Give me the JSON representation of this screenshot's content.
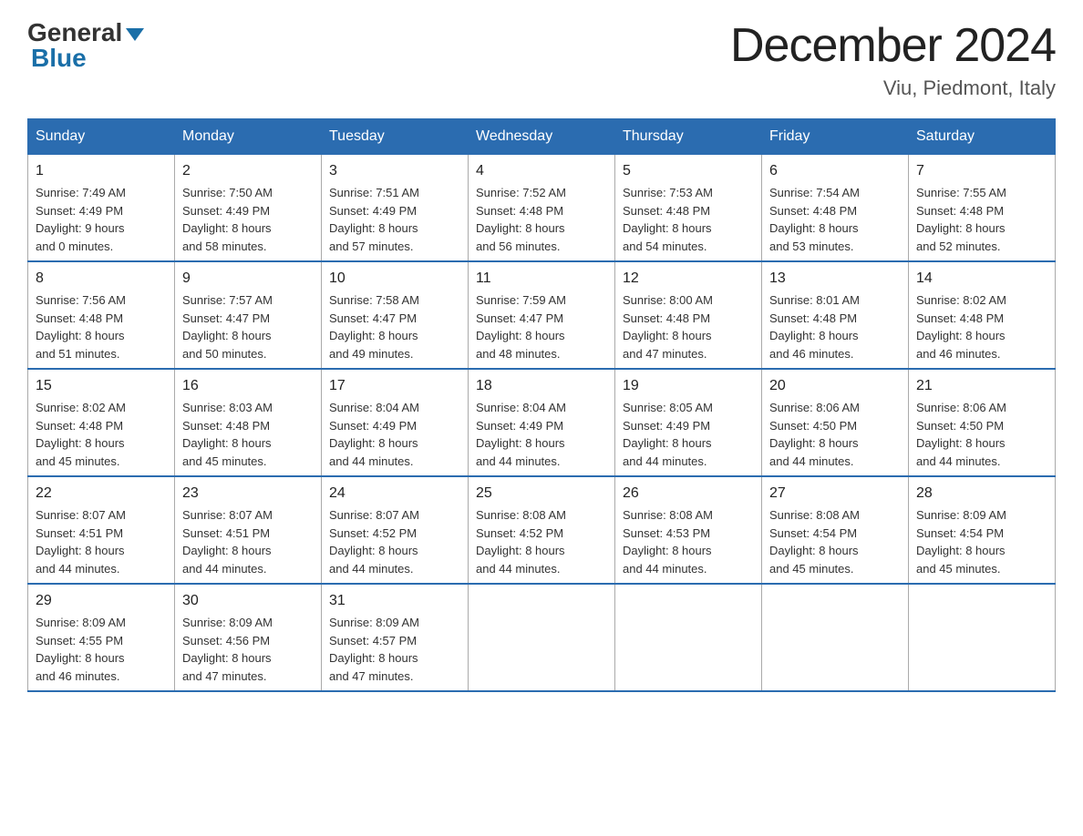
{
  "header": {
    "logo_general": "General",
    "logo_blue": "Blue",
    "month_title": "December 2024",
    "subtitle": "Viu, Piedmont, Italy"
  },
  "days_of_week": [
    "Sunday",
    "Monday",
    "Tuesday",
    "Wednesday",
    "Thursday",
    "Friday",
    "Saturday"
  ],
  "weeks": [
    [
      {
        "day": "1",
        "sunrise": "7:49 AM",
        "sunset": "4:49 PM",
        "daylight": "9 hours and 0 minutes."
      },
      {
        "day": "2",
        "sunrise": "7:50 AM",
        "sunset": "4:49 PM",
        "daylight": "8 hours and 58 minutes."
      },
      {
        "day": "3",
        "sunrise": "7:51 AM",
        "sunset": "4:49 PM",
        "daylight": "8 hours and 57 minutes."
      },
      {
        "day": "4",
        "sunrise": "7:52 AM",
        "sunset": "4:48 PM",
        "daylight": "8 hours and 56 minutes."
      },
      {
        "day": "5",
        "sunrise": "7:53 AM",
        "sunset": "4:48 PM",
        "daylight": "8 hours and 54 minutes."
      },
      {
        "day": "6",
        "sunrise": "7:54 AM",
        "sunset": "4:48 PM",
        "daylight": "8 hours and 53 minutes."
      },
      {
        "day": "7",
        "sunrise": "7:55 AM",
        "sunset": "4:48 PM",
        "daylight": "8 hours and 52 minutes."
      }
    ],
    [
      {
        "day": "8",
        "sunrise": "7:56 AM",
        "sunset": "4:48 PM",
        "daylight": "8 hours and 51 minutes."
      },
      {
        "day": "9",
        "sunrise": "7:57 AM",
        "sunset": "4:47 PM",
        "daylight": "8 hours and 50 minutes."
      },
      {
        "day": "10",
        "sunrise": "7:58 AM",
        "sunset": "4:47 PM",
        "daylight": "8 hours and 49 minutes."
      },
      {
        "day": "11",
        "sunrise": "7:59 AM",
        "sunset": "4:47 PM",
        "daylight": "8 hours and 48 minutes."
      },
      {
        "day": "12",
        "sunrise": "8:00 AM",
        "sunset": "4:48 PM",
        "daylight": "8 hours and 47 minutes."
      },
      {
        "day": "13",
        "sunrise": "8:01 AM",
        "sunset": "4:48 PM",
        "daylight": "8 hours and 46 minutes."
      },
      {
        "day": "14",
        "sunrise": "8:02 AM",
        "sunset": "4:48 PM",
        "daylight": "8 hours and 46 minutes."
      }
    ],
    [
      {
        "day": "15",
        "sunrise": "8:02 AM",
        "sunset": "4:48 PM",
        "daylight": "8 hours and 45 minutes."
      },
      {
        "day": "16",
        "sunrise": "8:03 AM",
        "sunset": "4:48 PM",
        "daylight": "8 hours and 45 minutes."
      },
      {
        "day": "17",
        "sunrise": "8:04 AM",
        "sunset": "4:49 PM",
        "daylight": "8 hours and 44 minutes."
      },
      {
        "day": "18",
        "sunrise": "8:04 AM",
        "sunset": "4:49 PM",
        "daylight": "8 hours and 44 minutes."
      },
      {
        "day": "19",
        "sunrise": "8:05 AM",
        "sunset": "4:49 PM",
        "daylight": "8 hours and 44 minutes."
      },
      {
        "day": "20",
        "sunrise": "8:06 AM",
        "sunset": "4:50 PM",
        "daylight": "8 hours and 44 minutes."
      },
      {
        "day": "21",
        "sunrise": "8:06 AM",
        "sunset": "4:50 PM",
        "daylight": "8 hours and 44 minutes."
      }
    ],
    [
      {
        "day": "22",
        "sunrise": "8:07 AM",
        "sunset": "4:51 PM",
        "daylight": "8 hours and 44 minutes."
      },
      {
        "day": "23",
        "sunrise": "8:07 AM",
        "sunset": "4:51 PM",
        "daylight": "8 hours and 44 minutes."
      },
      {
        "day": "24",
        "sunrise": "8:07 AM",
        "sunset": "4:52 PM",
        "daylight": "8 hours and 44 minutes."
      },
      {
        "day": "25",
        "sunrise": "8:08 AM",
        "sunset": "4:52 PM",
        "daylight": "8 hours and 44 minutes."
      },
      {
        "day": "26",
        "sunrise": "8:08 AM",
        "sunset": "4:53 PM",
        "daylight": "8 hours and 44 minutes."
      },
      {
        "day": "27",
        "sunrise": "8:08 AM",
        "sunset": "4:54 PM",
        "daylight": "8 hours and 45 minutes."
      },
      {
        "day": "28",
        "sunrise": "8:09 AM",
        "sunset": "4:54 PM",
        "daylight": "8 hours and 45 minutes."
      }
    ],
    [
      {
        "day": "29",
        "sunrise": "8:09 AM",
        "sunset": "4:55 PM",
        "daylight": "8 hours and 46 minutes."
      },
      {
        "day": "30",
        "sunrise": "8:09 AM",
        "sunset": "4:56 PM",
        "daylight": "8 hours and 47 minutes."
      },
      {
        "day": "31",
        "sunrise": "8:09 AM",
        "sunset": "4:57 PM",
        "daylight": "8 hours and 47 minutes."
      },
      null,
      null,
      null,
      null
    ]
  ]
}
